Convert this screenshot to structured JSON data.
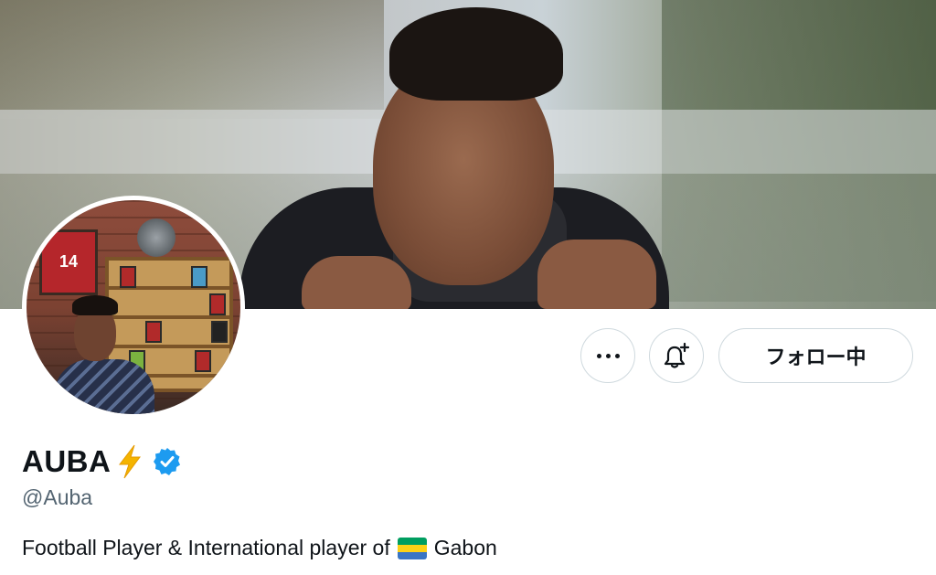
{
  "profile": {
    "display_name": "AUBA",
    "name_emoji": "lightning-bolt-icon",
    "verified": true,
    "handle": "@Auba",
    "bio_text": "Football Player & International player of",
    "bio_flag": "gabon-flag-icon",
    "bio_country": "Gabon"
  },
  "avatar": {
    "jersey_number": "14"
  },
  "actions": {
    "more_icon": "more-dots-icon",
    "notify_icon": "bell-plus-icon",
    "follow_label": "フォロー中"
  },
  "colors": {
    "verified_blue": "#1d9bf0",
    "bolt_yellow": "#f4b400",
    "handle_gray": "#536471",
    "border_gray": "#cfd9de",
    "flag_green": "#009e60",
    "flag_yellow": "#fcd116",
    "flag_blue": "#3a75c4"
  }
}
